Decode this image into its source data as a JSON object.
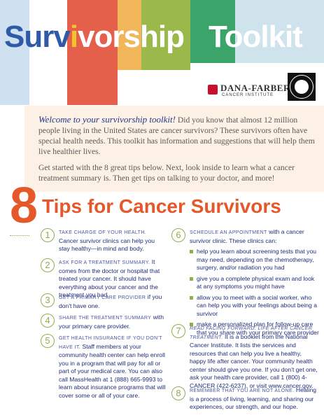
{
  "banner": {
    "title_part1": "Surv",
    "title_i": "i",
    "title_part2": "vorship",
    "title_part3": "Toolkit",
    "colors": [
      "#2e5aa8",
      "#e8604a",
      "#f2a83a",
      "#9ab94a",
      "#3aa46a"
    ]
  },
  "logos": {
    "dana_farber": "DANA-FARBER",
    "dana_farber_sub": "CANCER INSTITUTE",
    "seal_city": "BOSTON"
  },
  "welcome": {
    "lead": "Welcome to your survivorship toolkit!",
    "p1": "Did you know that almost 12 million people living in the United States are cancer survivors? These survivors often have special health needs. This toolkit has information and suggestions that will help them live healthier lives.",
    "p2": "Get started with the 8 great tips below. Next, look inside to learn what a cancer treatment summary is. Then get tips on talking to your doctor, and more!"
  },
  "section": {
    "number": "8",
    "title": "Tips for Cancer Survivors"
  },
  "tips": [
    {
      "n": "1",
      "head": "TAKE CHARGE OF YOUR HEALTH.",
      "body": "Cancer survivor clinics can help you stay healthy—in mind and body."
    },
    {
      "n": "2",
      "head": "ASK FOR A TREATMENT SUMMARY.",
      "body": "It comes from the doctor or hospital that treated your cancer. It should have everything about your cancer and the treatment you had."
    },
    {
      "n": "3",
      "head": "GET A PRIMARY CARE PROVIDER",
      "body": "if you don't have one."
    },
    {
      "n": "4",
      "head": "SHARE THE TREATMENT SUMMARY",
      "body": "with your primary care provider."
    },
    {
      "n": "5",
      "head": "GET HEALTH INSURANCE IF YOU DON'T HAVE IT.",
      "body": "Staff members at your community health center can help enroll you in a program that will pay for all or part of your medical care. You can also call MassHealth at 1 (888) 665-9993 to learn about insurance programs that will cover some or all of your care."
    },
    {
      "n": "6",
      "head": "SCHEDULE AN APPOINTMENT",
      "body": "with a cancer survivor clinic. These clinics can:",
      "bullets": [
        "help you learn about screening tests that you may need, depending on the chemotherapy, surgery, and/or radiation you had",
        "give you a complete physical exam and look at any symptoms you might have",
        "allow you to meet with a social worker, who can help you with your feelings about being a survivor",
        "make a personalized plan for follow-up care that you share with your primary care provider"
      ]
    },
    {
      "n": "7",
      "head": "READ FACING FORWARD: LIFE AFTER CANCER TREATMENT.",
      "body": "It is a booklet from the National Cancer Institute. It lists the services and resources that can help you live a healthy, happy life after cancer. Your community health center should give you one. If you don't get one, ask your health care provider, call 1 (800) 4-CANCER (422-6237), or visit www.cancer.gov."
    },
    {
      "n": "8",
      "head": "REMEMBER THAT YOU ARE NOT ALONE.",
      "body": "Healing is a process of living, learning, and sharing our experiences, our strength, and our hope."
    }
  ]
}
